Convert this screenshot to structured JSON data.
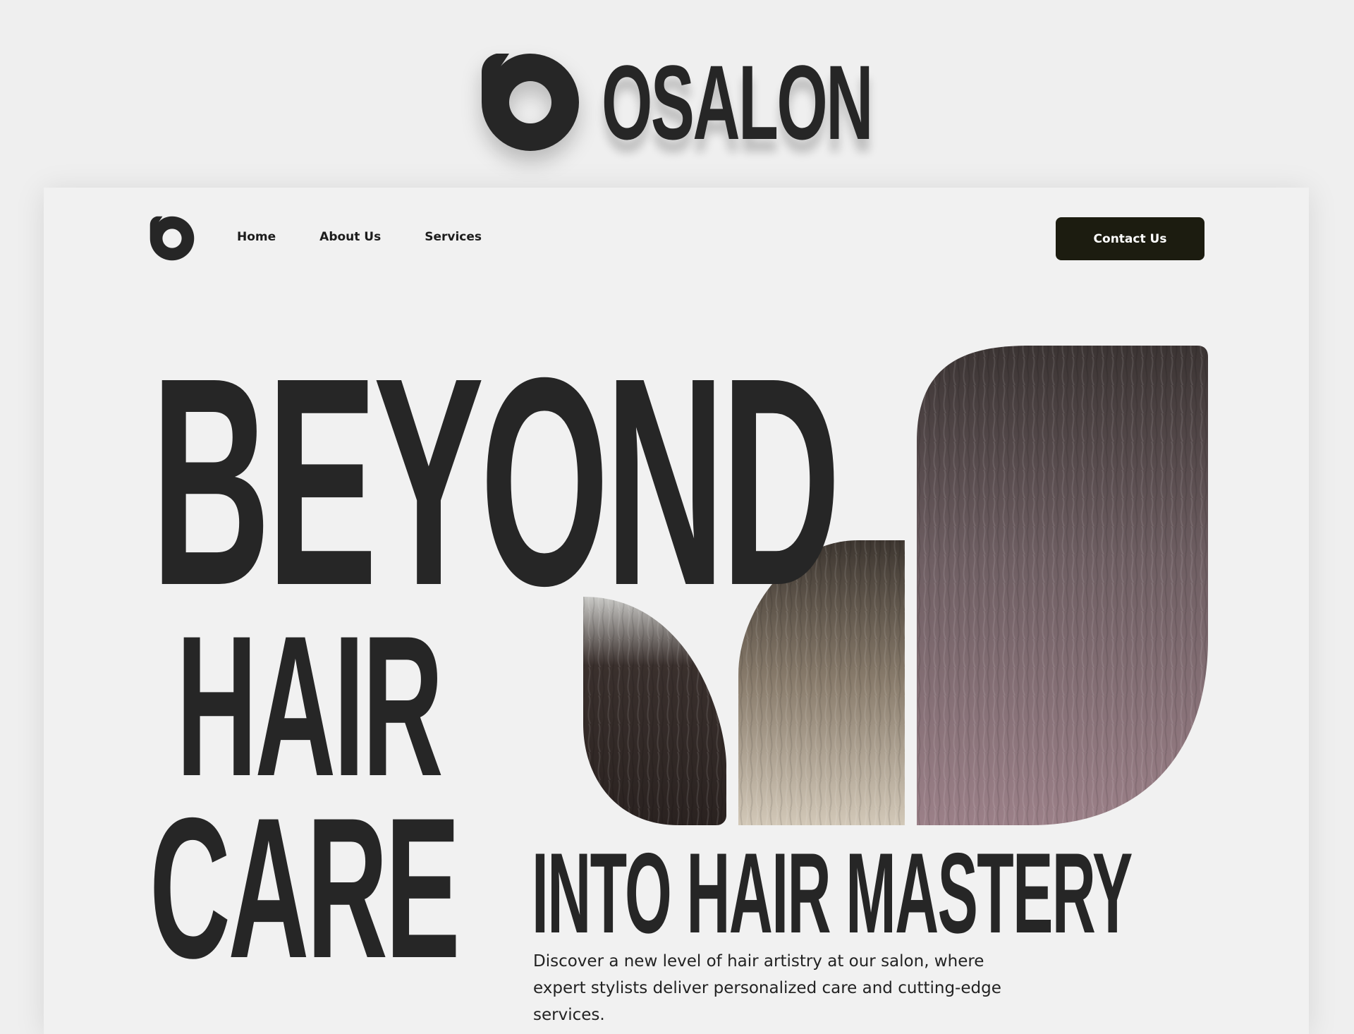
{
  "brand": {
    "wordmark": "OSALON"
  },
  "nav": {
    "links": [
      "Home",
      "About Us",
      "Services"
    ],
    "contact_label": "Contact Us"
  },
  "hero": {
    "line1": "BEYOND",
    "line2": "HAIR",
    "line3": "CARE",
    "line4": "INTO HAIR MASTERY",
    "tagline": "Discover a new level of hair artistry at our salon, where expert stylists deliver personalized care and cutting-edge services."
  },
  "colors": {
    "ink": "#262626",
    "button": "#1c1c10",
    "background": "#efefef"
  },
  "icons": {
    "logo": "salon-logo-icon"
  }
}
